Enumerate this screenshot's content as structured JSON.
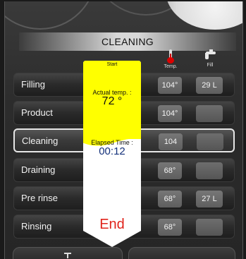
{
  "title": "CLEANING",
  "columns": {
    "temp_label": "Temp.",
    "fill_label": "Fill",
    "temp_icon": "thermometer-icon",
    "fill_icon": "water-tap-icon"
  },
  "rows": [
    {
      "name": "Filling",
      "temp": "104°",
      "fill": "29 L"
    },
    {
      "name": "Product",
      "temp": "104°",
      "fill": ""
    },
    {
      "name": "Cleaning",
      "temp": "104",
      "fill": ""
    },
    {
      "name": "Draining",
      "temp": "68°",
      "fill": ""
    },
    {
      "name": "Pre rinse",
      "temp": "68°",
      "fill": "27 L"
    },
    {
      "name": "Rinsing",
      "temp": "68°",
      "fill": ""
    }
  ],
  "active_row": "Cleaning",
  "gauge": {
    "start_label": "Start",
    "actual_label": "Actual temp. :",
    "actual_value": "72  °",
    "elapsed_label": "Elapsed Time :",
    "elapsed_value": "00:12",
    "end_label": "End",
    "progress_fraction": 0.45,
    "fill_color": "#ffff00",
    "empty_color": "#ffffff"
  },
  "colors": {
    "end_text": "#e0231b",
    "elapsed_text": "#13307a"
  }
}
